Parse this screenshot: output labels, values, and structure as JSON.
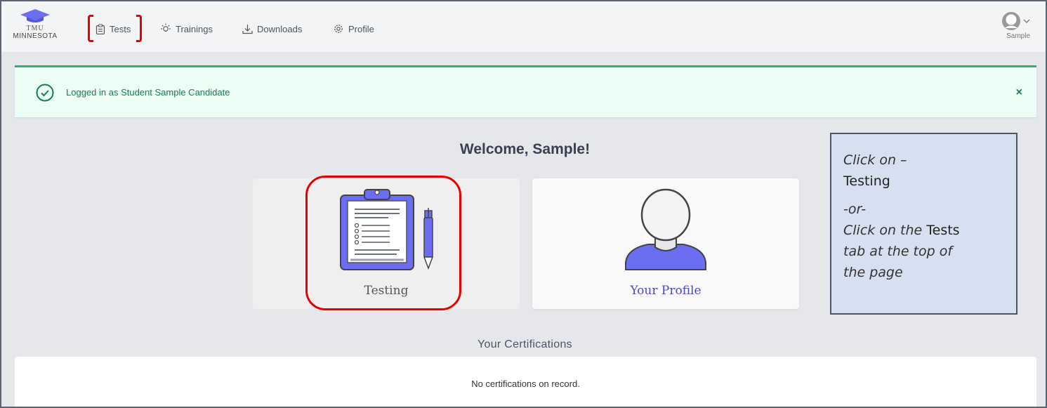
{
  "brand": {
    "line1": "TMU",
    "line2": "MINNESOTA",
    "icon": "graduation-cap-icon"
  },
  "nav": {
    "items": [
      {
        "label": "Tests",
        "icon": "clipboard-icon"
      },
      {
        "label": "Trainings",
        "icon": "lightbulb-icon"
      },
      {
        "label": "Downloads",
        "icon": "download-icon"
      },
      {
        "label": "Profile",
        "icon": "gear-icon"
      }
    ],
    "user_name": "Sample"
  },
  "alert": {
    "message": "Logged in as Student Sample Candidate",
    "close_label": "×"
  },
  "main": {
    "welcome": "Welcome, Sample!",
    "cards": [
      {
        "label": "Testing",
        "icon": "clipboard-pen-icon"
      },
      {
        "label": "Your Profile",
        "icon": "person-icon"
      }
    ],
    "certifications_title": "Your Certifications",
    "certifications_empty": "No certifications on record."
  },
  "annotation": {
    "line1": "Click on –",
    "line2": "Testing",
    "line3": "-or-",
    "line4a": "Click on the ",
    "line4b": "Tests",
    "line5": "tab at the top of",
    "line6": "the page"
  },
  "colors": {
    "accent": "#6b6ef0",
    "success": "#22b573",
    "highlight_red": "#e60000",
    "note_bg": "#d7e0f0"
  }
}
